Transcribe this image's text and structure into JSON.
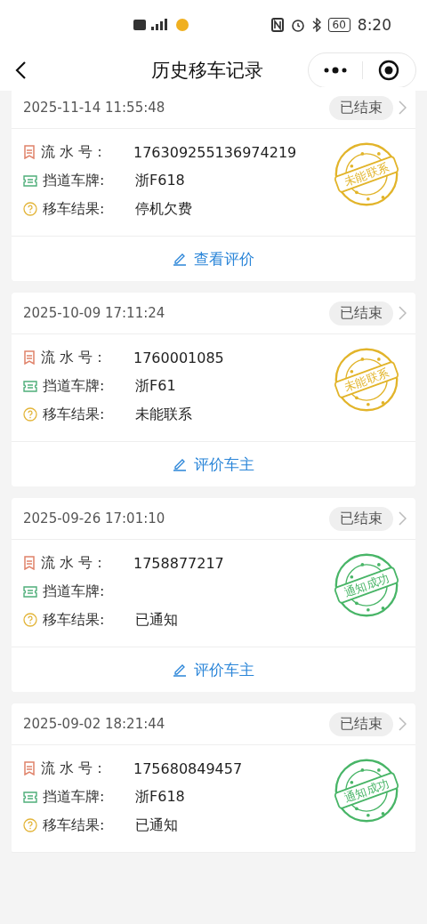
{
  "status_bar": {
    "battery": "60",
    "time": "8:20"
  },
  "nav": {
    "title": "历史移车记录"
  },
  "records": [
    {
      "time": "2025-11-14 11:55:48",
      "status": "已结束",
      "fields": [
        {
          "kind": "serial",
          "label": "流 水 号：",
          "value": "176309255136974219"
        },
        {
          "kind": "plate",
          "label": "挡道车牌:",
          "value": "浙F618"
        },
        {
          "kind": "result",
          "label": "移车结果:",
          "value": "停机欠费"
        }
      ],
      "stamp": {
        "kind": "failed",
        "text": "未能联系"
      },
      "action": "查看评价"
    },
    {
      "time": "2025-10-09 17:11:24",
      "status": "已结束",
      "fields": [
        {
          "kind": "serial",
          "label": "流 水 号：",
          "value": "1760001085"
        },
        {
          "kind": "plate",
          "label": "挡道车牌:",
          "value": "浙F61"
        },
        {
          "kind": "result",
          "label": "移车结果:",
          "value": "未能联系"
        }
      ],
      "stamp": {
        "kind": "failed",
        "text": "未能联系"
      },
      "action": "评价车主"
    },
    {
      "time": "2025-09-26 17:01:10",
      "status": "已结束",
      "fields": [
        {
          "kind": "serial",
          "label": "流 水 号：",
          "value": "1758877217"
        },
        {
          "kind": "plate",
          "label": "挡道车牌:"
        },
        {
          "kind": "result",
          "label": "移车结果:",
          "value": "已通知"
        }
      ],
      "stamp": {
        "kind": "success",
        "text": "通知成功"
      },
      "action": "评价车主"
    },
    {
      "time": "2025-09-02 18:21:44",
      "status": "已结束",
      "fields": [
        {
          "kind": "serial",
          "label": "流 水 号：",
          "value": "175680849457"
        },
        {
          "kind": "plate",
          "label": "挡道车牌:",
          "value": "浙F618"
        },
        {
          "kind": "result",
          "label": "移车结果:",
          "value": "已通知"
        }
      ],
      "stamp": {
        "kind": "success",
        "text": "通知成功"
      }
    }
  ]
}
